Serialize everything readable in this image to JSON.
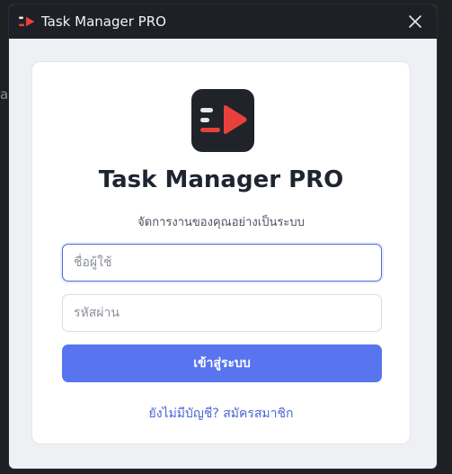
{
  "window": {
    "title": "Task Manager PRO",
    "icons": {
      "app": "app-logo-icon",
      "close": "close-icon"
    }
  },
  "desktop": {
    "edge_text": "a"
  },
  "login": {
    "app_name": "Task Manager PRO",
    "subtitle": "จัดการงานของคุณอย่างเป็นระบบ",
    "username_placeholder": "ชื่อผู้ใช้",
    "password_placeholder": "รหัสผ่าน",
    "login_label": "เข้าสู่ระบบ",
    "signup_link": "ยังไม่มีบัญชี? สมัครสมาชิก"
  },
  "colors": {
    "primary": "#5874ee",
    "link": "#4b66d6",
    "logo_red": "#e8413c",
    "titlebar": "#1d2027"
  }
}
